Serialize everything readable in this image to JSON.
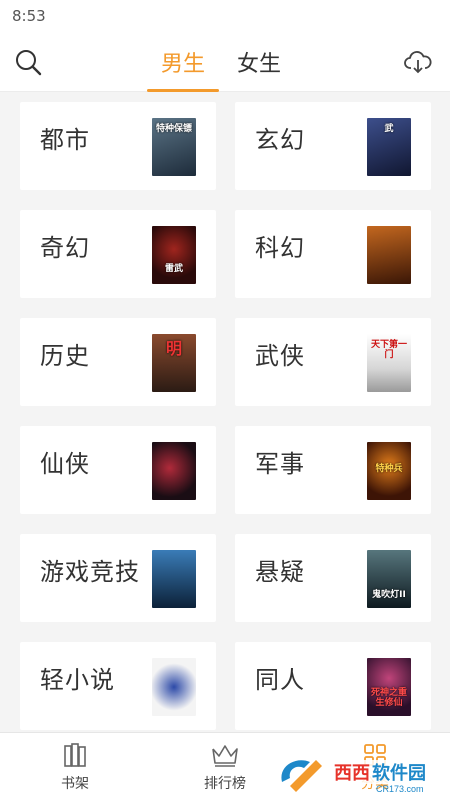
{
  "status": {
    "time": "8:53"
  },
  "header": {
    "tabs": [
      {
        "label": "男生",
        "active": true
      },
      {
        "label": "女生",
        "active": false
      }
    ]
  },
  "categories": [
    {
      "name": "都市",
      "cover_title": "特种保镖",
      "cover_colors": [
        "#1d2b3a",
        "#5b7486"
      ]
    },
    {
      "name": "玄幻",
      "cover_title": "武",
      "cover_colors": [
        "#101630",
        "#3d4f8c"
      ]
    },
    {
      "name": "奇幻",
      "cover_title": "雷武",
      "cover_colors": [
        "#2a0a0a",
        "#a0251e"
      ]
    },
    {
      "name": "科幻",
      "cover_title": "",
      "cover_colors": [
        "#3a1606",
        "#c3671f"
      ]
    },
    {
      "name": "历史",
      "cover_title": "明",
      "cover_colors": [
        "#2b1b14",
        "#8a4a2e"
      ]
    },
    {
      "name": "武侠",
      "cover_title": "天下第一门",
      "cover_colors": [
        "#e9e9e9",
        "#9a9a9a"
      ]
    },
    {
      "name": "仙侠",
      "cover_title": "",
      "cover_colors": [
        "#1a0d14",
        "#b02a3a"
      ]
    },
    {
      "name": "军事",
      "cover_title": "特种兵",
      "cover_colors": [
        "#3d1406",
        "#e07c1a"
      ]
    },
    {
      "name": "游戏竞技",
      "cover_title": "",
      "cover_colors": [
        "#0c2138",
        "#3a7cb7"
      ]
    },
    {
      "name": "悬疑",
      "cover_title": "鬼吹灯ⅠⅠ",
      "cover_colors": [
        "#0e1a20",
        "#57767d"
      ]
    },
    {
      "name": "轻小说",
      "cover_title": "",
      "cover_colors": [
        "#f4f4f4",
        "#2d4aa8"
      ]
    },
    {
      "name": "同人",
      "cover_title": "死神之重生修仙",
      "cover_colors": [
        "#2a0f2a",
        "#c0447a"
      ]
    }
  ],
  "bottom_nav": [
    {
      "label": "书架",
      "icon": "bookshelf-icon",
      "active": false
    },
    {
      "label": "排行榜",
      "icon": "crown-icon",
      "active": false
    },
    {
      "label": "分类",
      "icon": "category-icon",
      "active": true
    }
  ],
  "watermark": {
    "brand": "西西软件园",
    "url": "CR173.com"
  },
  "colors": {
    "accent": "#f39a2c",
    "background": "#f4f4f4"
  }
}
